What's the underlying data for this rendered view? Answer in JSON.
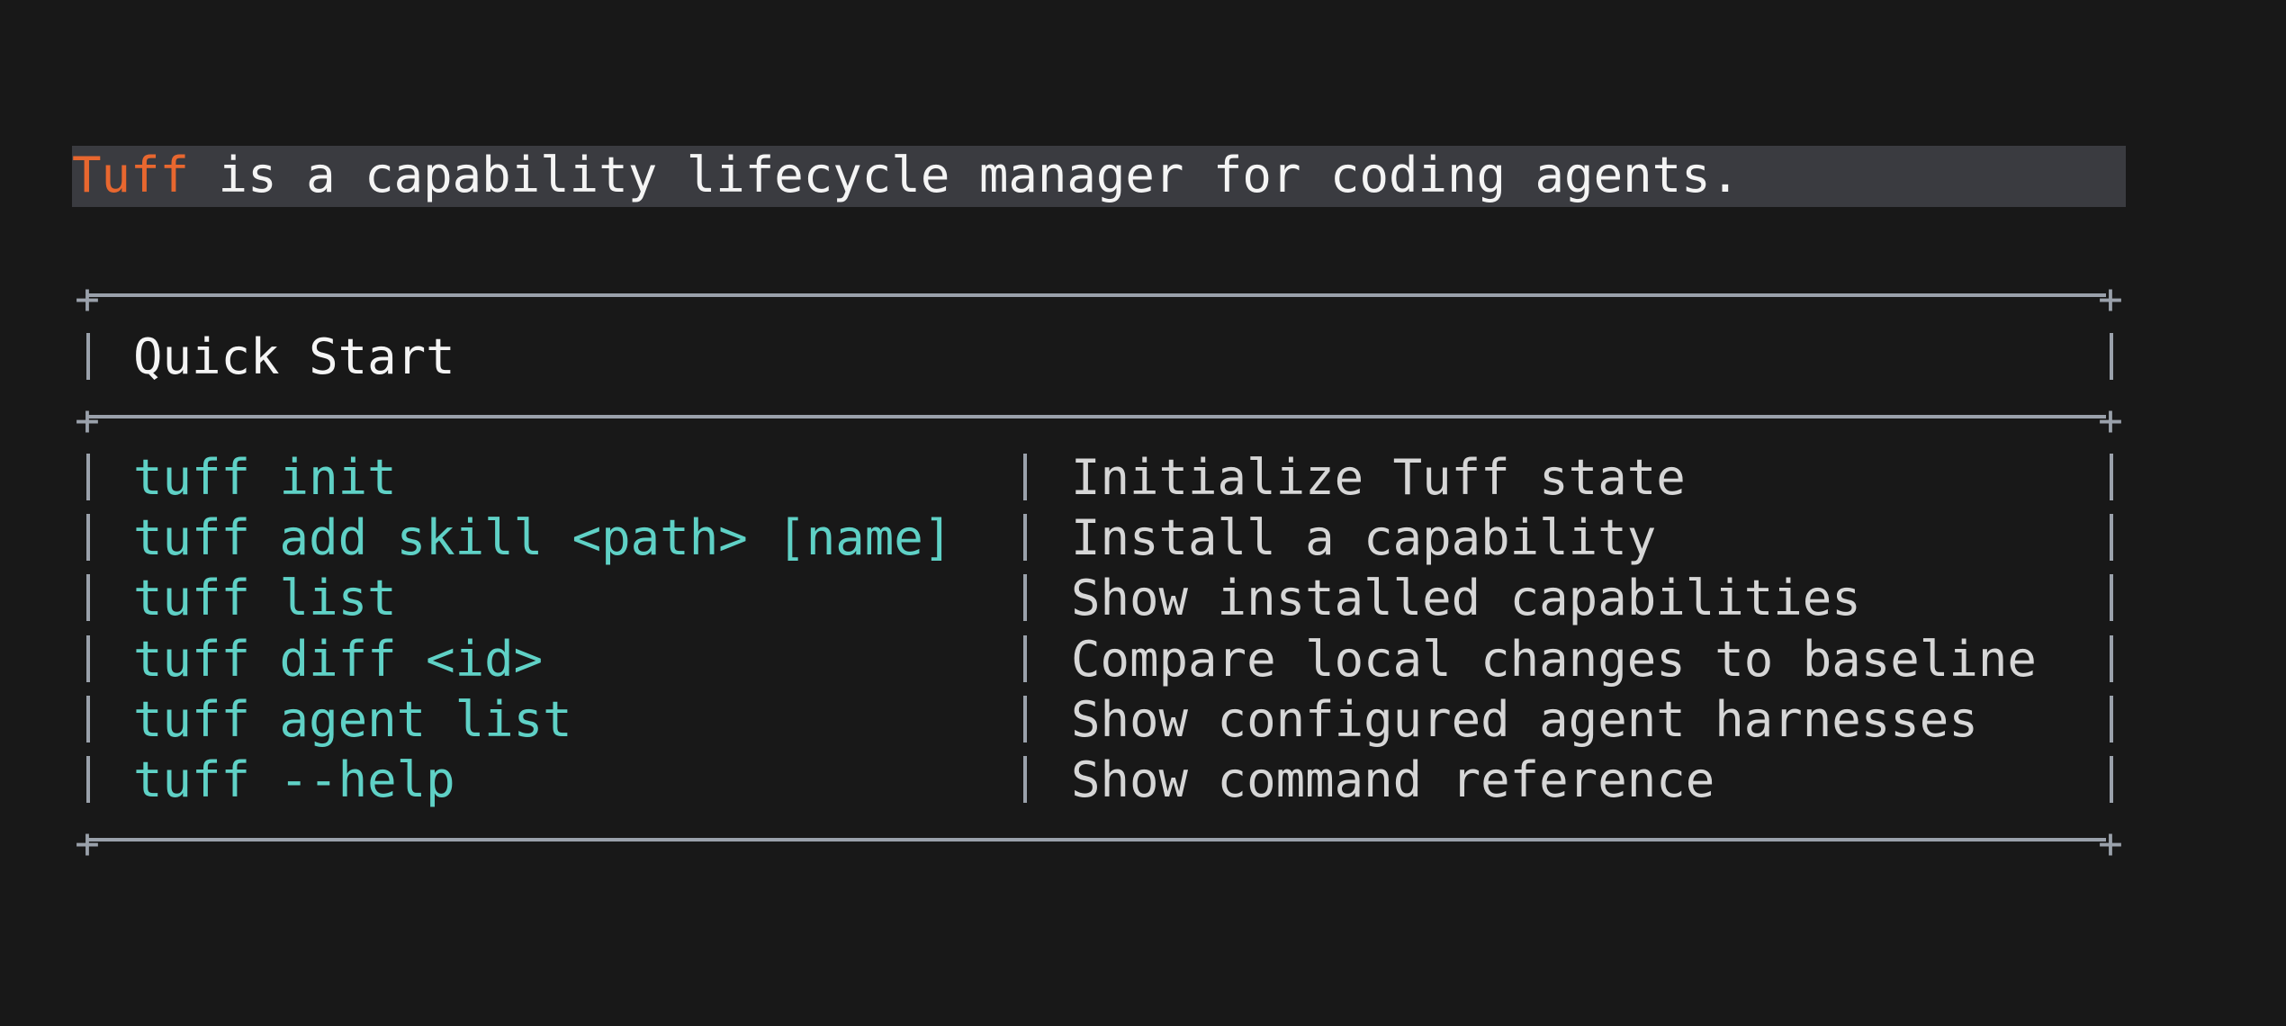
{
  "intro": {
    "brand": "Tuff",
    "text": " is a capability lifecycle manager for coding agents."
  },
  "quick_start": {
    "title": "Quick Start",
    "rows": [
      {
        "command": "tuff init",
        "description": "Initialize Tuff state"
      },
      {
        "command": "tuff add skill <path> [name]",
        "description": "Install a capability"
      },
      {
        "command": "tuff list",
        "description": "Show installed capabilities"
      },
      {
        "command": "tuff diff <id>",
        "description": "Compare local changes to baseline"
      },
      {
        "command": "tuff agent list",
        "description": "Show configured agent harnesses"
      },
      {
        "command": "tuff --help",
        "description": "Show command reference"
      }
    ]
  },
  "colors": {
    "background": "#181818",
    "brand": "#e8672f",
    "command": "#5fd1c6",
    "border": "#9aa1ab",
    "highlight": "#3a3b40"
  }
}
